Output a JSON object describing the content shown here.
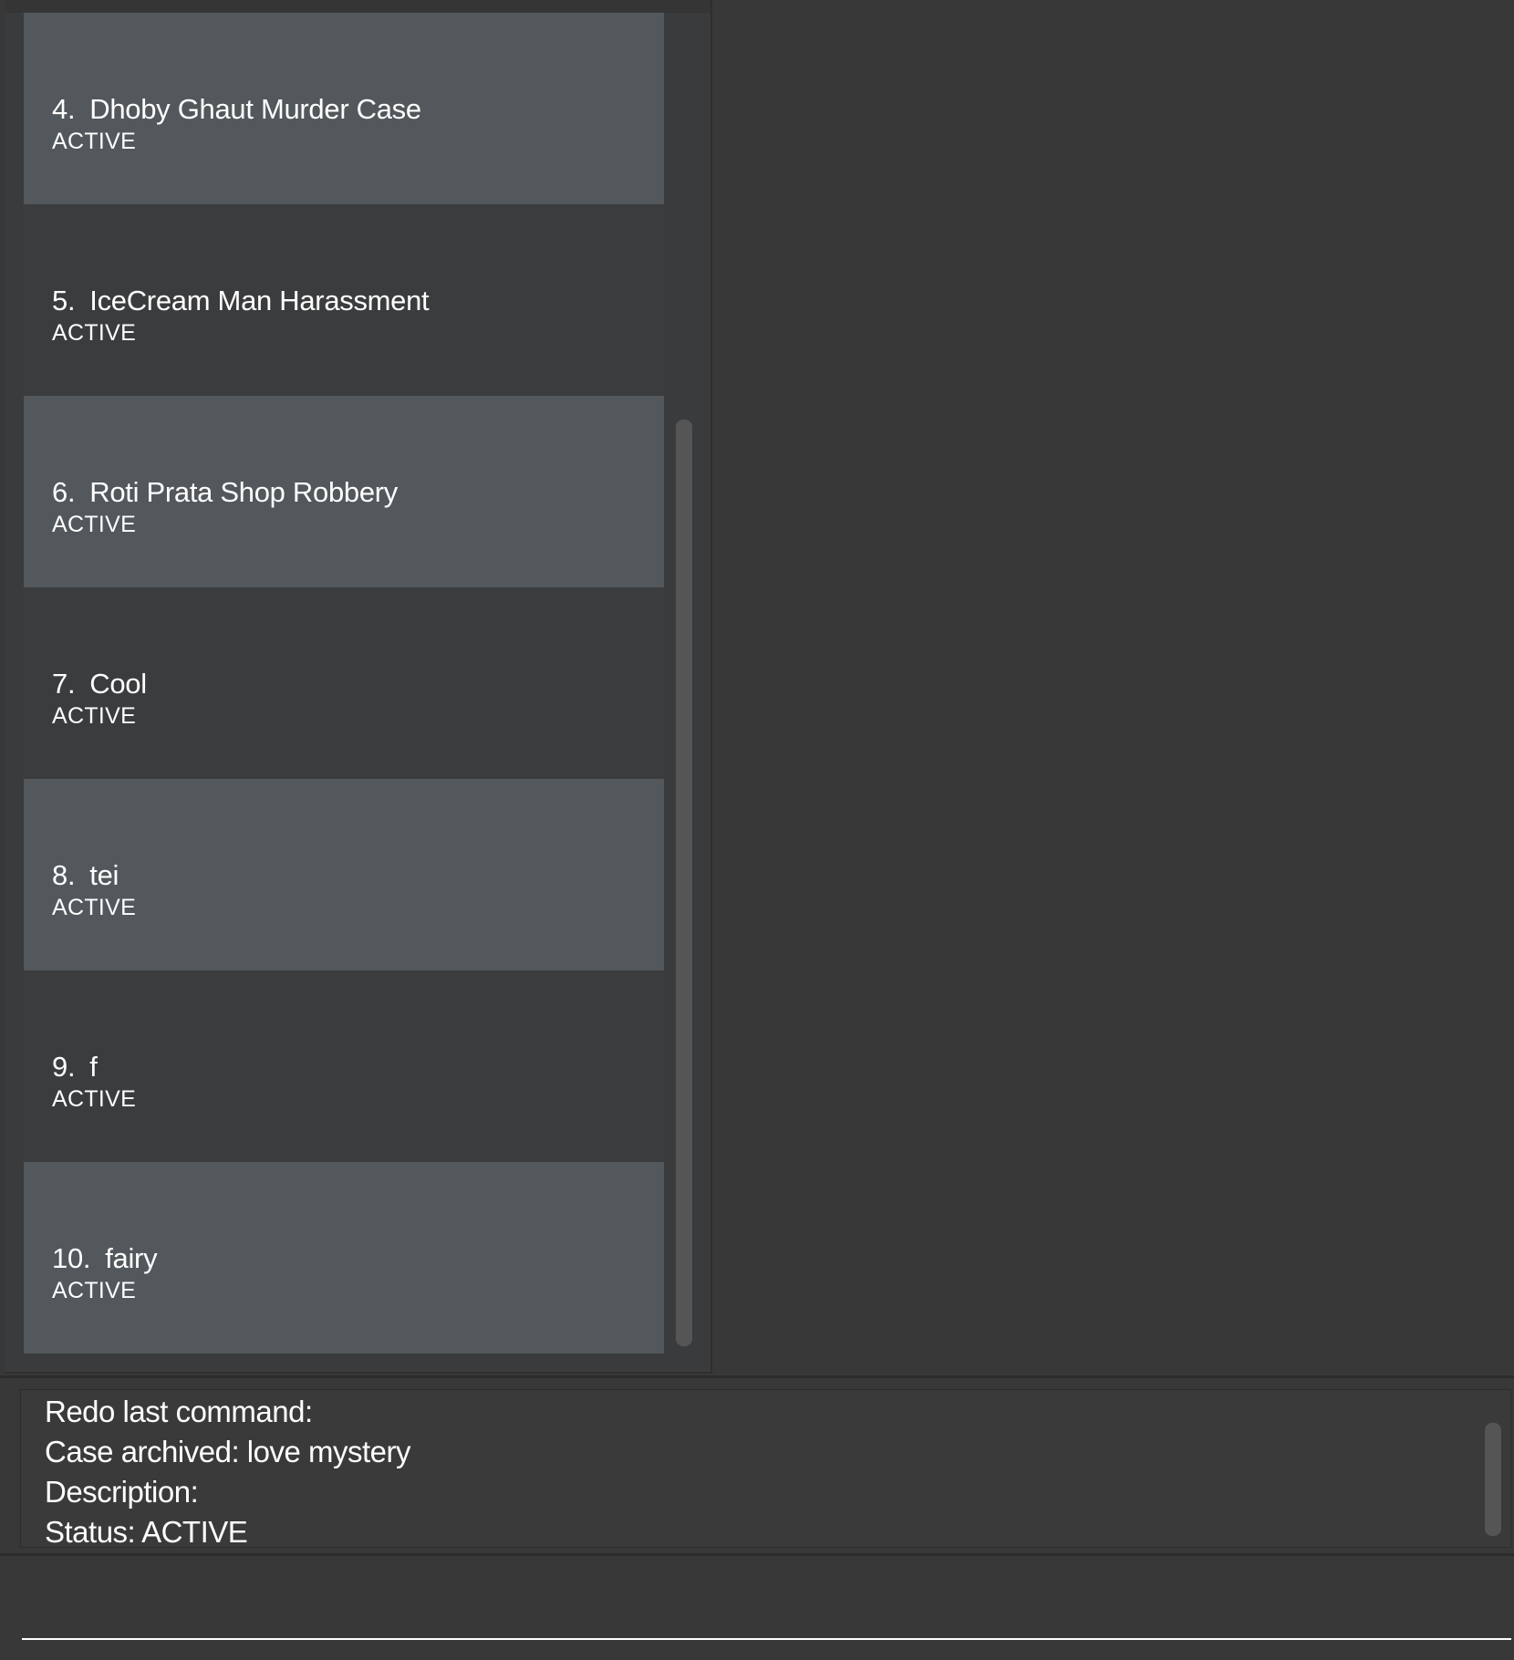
{
  "case_list": {
    "items": [
      {
        "index": "4.",
        "title": "Dhoby Ghaut Murder Case",
        "status": "ACTIVE"
      },
      {
        "index": "5.",
        "title": "IceCream Man Harassment",
        "status": "ACTIVE"
      },
      {
        "index": "6.",
        "title": "Roti Prata Shop Robbery",
        "status": "ACTIVE"
      },
      {
        "index": "7.",
        "title": "Cool",
        "status": "ACTIVE"
      },
      {
        "index": "8.",
        "title": "tei",
        "status": "ACTIVE"
      },
      {
        "index": "9.",
        "title": "f",
        "status": "ACTIVE"
      },
      {
        "index": "10.",
        "title": "fairy",
        "status": "ACTIVE"
      }
    ]
  },
  "result_display": {
    "lines": [
      "Redo last command:",
      "Case archived: love mystery",
      "Description:",
      "Status: ACTIVE"
    ]
  },
  "command_box": {
    "value": ""
  },
  "colors": {
    "background": "#383838",
    "card_even": "#52585b",
    "card_odd": "#3b3c3e",
    "text": "#ffffff",
    "scrollbar": "#555555"
  }
}
